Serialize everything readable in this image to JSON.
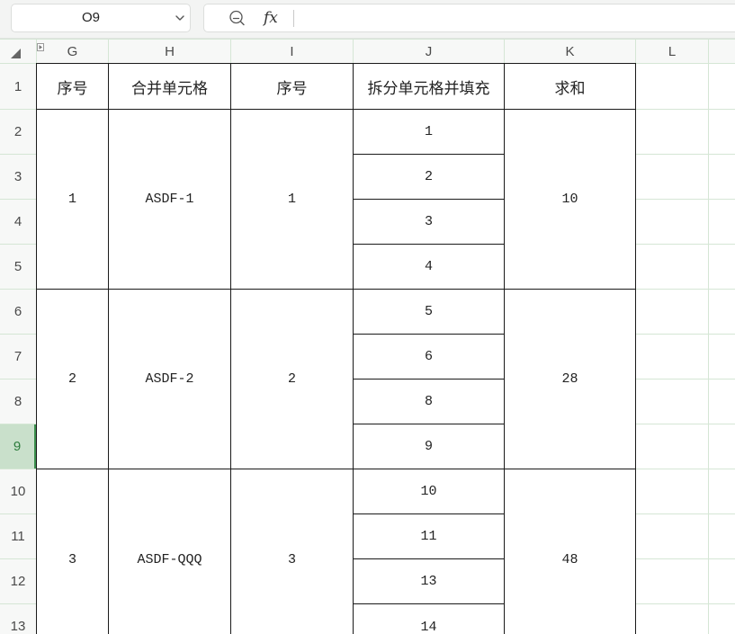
{
  "name_box": {
    "value": "O9",
    "dropdown_icon": "chevron-down-icon"
  },
  "formula_bar": {
    "search_icon": "search-icon",
    "fx_label": "fx"
  },
  "sheet": {
    "select_all_icon": "select-all-triangle-icon",
    "hidden_columns_icon": "expand-hidden-columns-icon",
    "column_headers": [
      "G",
      "H",
      "I",
      "J",
      "K",
      "L"
    ],
    "row_headers": [
      {
        "label": "1"
      },
      {
        "label": "2"
      },
      {
        "label": "3"
      },
      {
        "label": "4"
      },
      {
        "label": "5"
      },
      {
        "label": "6"
      },
      {
        "label": "7"
      },
      {
        "label": "8"
      },
      {
        "label": "9",
        "selected": true
      },
      {
        "label": "10"
      },
      {
        "label": "11"
      },
      {
        "label": "12"
      },
      {
        "label": "13"
      }
    ],
    "table": {
      "headers": [
        "序号",
        "合并单元格",
        "序号",
        "拆分单元格并填充",
        "求和"
      ],
      "groups": [
        {
          "index": "1",
          "merged": "ASDF-1",
          "seq": "1",
          "split": [
            "1",
            "2",
            "3",
            "4"
          ],
          "sum": "10"
        },
        {
          "index": "2",
          "merged": "ASDF-2",
          "seq": "2",
          "split": [
            "5",
            "6",
            "8",
            "9"
          ],
          "sum": "28"
        },
        {
          "index": "3",
          "merged": "ASDF-QQQ",
          "seq": "3",
          "split": [
            "10",
            "11",
            "13",
            "14"
          ],
          "sum": "48"
        }
      ]
    }
  },
  "colors": {
    "gridline": "#d5e6d5",
    "header_background": "#f7f8f7",
    "selected_row_header_background": "#c9e0cb",
    "selected_row_header_text": "#2e7d3e",
    "table_border": "#1a1a1a"
  }
}
